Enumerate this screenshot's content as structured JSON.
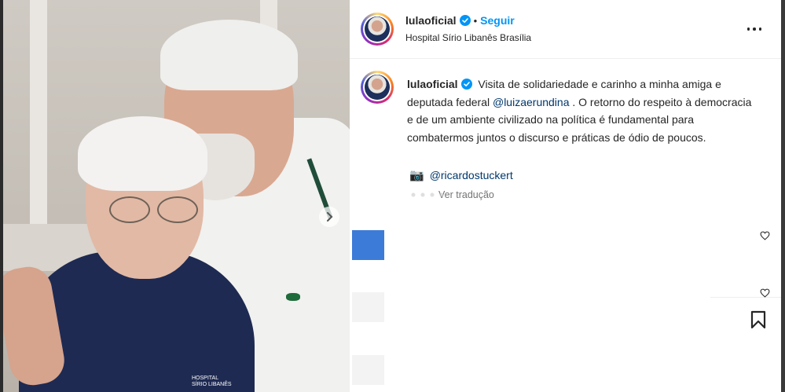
{
  "post": {
    "username": "lulaoficial",
    "follow_label": "Seguir",
    "separator": "•",
    "location": "Hospital Sírio Libanês Brasília",
    "badge_line1": "HOSPITAL",
    "badge_line2": "SÍRIO LIBANÊS"
  },
  "caption": {
    "username": "lulaoficial",
    "text_before_mention": "Visita de solidariedade e carinho a minha amiga e deputada federal ",
    "mention": "@luizaerundina",
    "text_after_mention": " . O retorno do respeito à democracia e de um ambiente civilizado na política é fundamental para combatermos juntos o discurso e práticas de ódio de poucos.",
    "camera_emoji": "📷",
    "credit": "@ricardostuckert",
    "translate_label": "Ver tradução"
  },
  "icons": {
    "verified": "verified-badge-icon",
    "more": "more-options-icon",
    "next": "chevron-right-icon",
    "heart": "heart-outline-icon",
    "bookmark": "bookmark-icon"
  },
  "colors": {
    "follow": "#0095f6",
    "mention": "#00376b",
    "verified": "#0095f6",
    "text": "#262626",
    "muted": "#737373"
  }
}
